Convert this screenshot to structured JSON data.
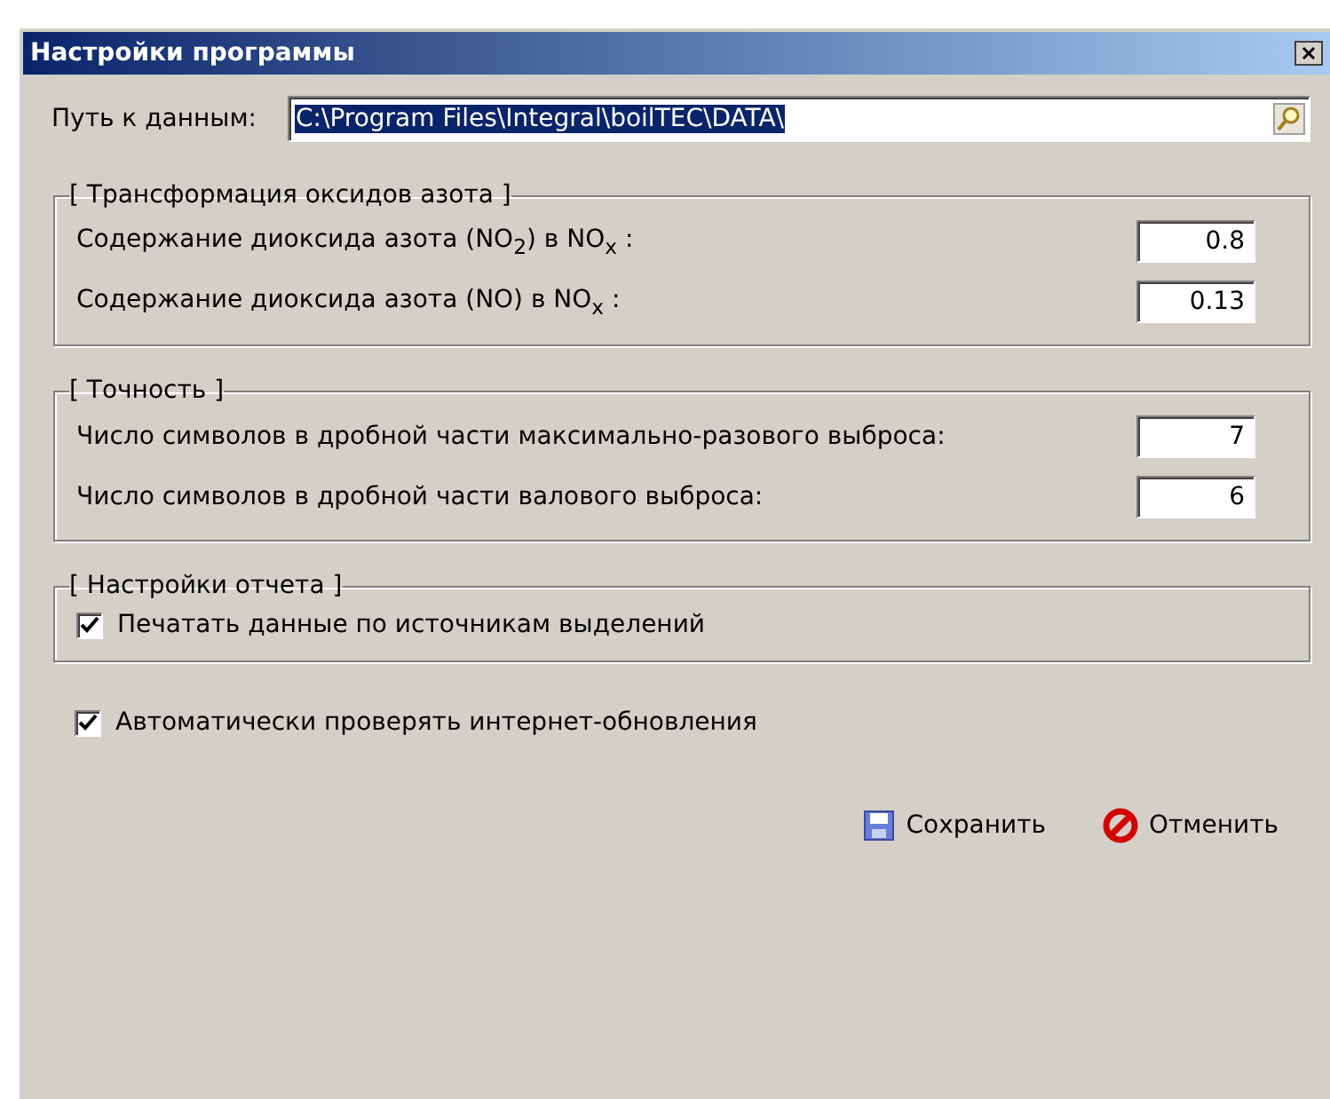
{
  "window": {
    "title": "Настройки программы"
  },
  "data_path": {
    "label": "Путь к данным:",
    "value": "C:\\Program Files\\Integral\\boilTEC\\DATA\\",
    "selected": true
  },
  "groups": [
    {
      "title": "[ Трансформация оксидов азота ]",
      "items": [
        {
          "kind": "number",
          "label": "Содержание диоксида азота (NO$_{2}$) в NO$_{x}$ :",
          "value": "0.8"
        },
        {
          "kind": "number",
          "label": "Содержание диоксида азота (NO) в NO$_{x}$ :",
          "value": "0.13"
        }
      ]
    },
    {
      "title": "[ Точность ]",
      "items": [
        {
          "kind": "number",
          "label": "Число символов в дробной части максимально-разового выброса:",
          "value": "7"
        },
        {
          "kind": "number",
          "label": "Число символов в дробной части валового выброса:",
          "value": "6"
        }
      ]
    },
    {
      "title": "[ Настройки отчета ]",
      "items": [
        {
          "kind": "checkbox",
          "label": "Печатать данные по источникам выделений",
          "checked": true
        }
      ]
    }
  ],
  "options": [
    {
      "label": "Автоматически проверять интернет-обновления",
      "checked": true
    }
  ],
  "buttons": [
    {
      "kind": "save",
      "label": "Сохранить"
    },
    {
      "kind": "cancel",
      "label": "Отменить"
    }
  ]
}
